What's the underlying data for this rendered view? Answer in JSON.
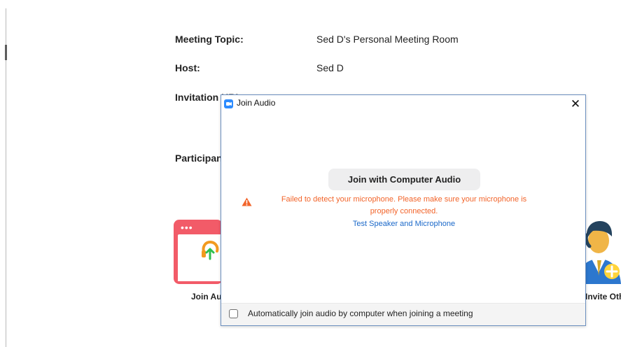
{
  "meeting": {
    "topic_label": "Meeting Topic:",
    "topic_value": "Sed D's Personal Meeting Room",
    "host_label": "Host:",
    "host_value": "Sed D",
    "invitation_label": "Invitation URL:",
    "participants_label": "Participants:"
  },
  "actions": {
    "join_audio_label": "Join Audio",
    "invite_others_label": "Invite Others"
  },
  "dialog": {
    "title": "Join Audio",
    "close_label": "✕",
    "join_button_label": "Join with Computer Audio",
    "warning_line_1": "Failed to detect your microphone. Please make sure your microphone is",
    "warning_line_2": "properly connected.",
    "test_link": "Test Speaker and Microphone",
    "auto_join_label": "Automatically join audio by computer when joining a meeting",
    "auto_join_checked": false
  },
  "colors": {
    "warning": "#f2642a",
    "link": "#1a68c9",
    "app_blue": "#2d8cff",
    "join_card_red": "#f25b68"
  },
  "icons": {
    "app": "zoom-app-icon",
    "warning": "warning-triangle-icon",
    "join_audio": "headphones-icon",
    "invite": "invite-person-icon",
    "close": "close-icon"
  }
}
